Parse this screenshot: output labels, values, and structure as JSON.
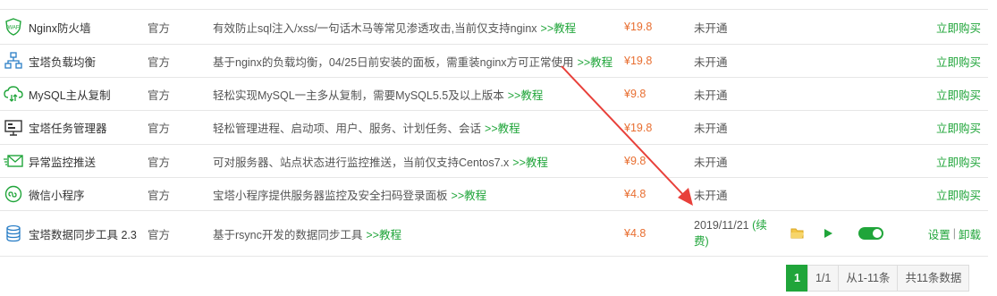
{
  "rows": [
    {
      "name": "Nginx防火墙",
      "developer": "官方",
      "description": "有效防止sql注入/xss/一句话木马等常见渗透攻击,当前仅支持nginx",
      "tutorial": ">>教程",
      "price": "¥19.8",
      "expiry": "未开通",
      "action": "立即购买",
      "icon": "waf-shield-icon"
    },
    {
      "name": "宝塔负载均衡",
      "developer": "官方",
      "description": "基于nginx的负载均衡，04/25日前安装的面板，需重装nginx方可正常使用",
      "tutorial": ">>教程",
      "price": "¥19.8",
      "expiry": "未开通",
      "action": "立即购买",
      "icon": "load-balance-icon"
    },
    {
      "name": "MySQL主从复制",
      "developer": "官方",
      "description": "轻松实现MySQL一主多从复制，需要MySQL5.5及以上版本",
      "tutorial": ">>教程",
      "price": "¥9.8",
      "expiry": "未开通",
      "action": "立即购买",
      "icon": "cloud-sync-icon"
    },
    {
      "name": "宝塔任务管理器",
      "developer": "官方",
      "description": "轻松管理进程、启动项、用户、服务、计划任务、会话",
      "tutorial": ">>教程",
      "price": "¥19.8",
      "expiry": "未开通",
      "action": "立即购买",
      "icon": "task-manager-icon"
    },
    {
      "name": "异常监控推送",
      "developer": "官方",
      "description": "可对服务器、站点状态进行监控推送，当前仅支持Centos7.x",
      "tutorial": ">>教程",
      "price": "¥9.8",
      "expiry": "未开通",
      "action": "立即购买",
      "icon": "mail-push-icon"
    },
    {
      "name": "微信小程序",
      "developer": "官方",
      "description": "宝塔小程序提供服务器监控及安全扫码登录面板",
      "tutorial": ">>教程",
      "price": "¥4.8",
      "expiry": "未开通",
      "action": "立即购买",
      "icon": "wechat-mini-icon"
    }
  ],
  "installed_row": {
    "name": "宝塔数据同步工具 2.3",
    "developer": "官方",
    "description": "基于rsync开发的数据同步工具",
    "tutorial": ">>教程",
    "price": "¥4.8",
    "expiry_date": "2019/11/21",
    "renew_open": "(续",
    "renew_close": "费)",
    "renew_text": "续费",
    "settings": "设置",
    "separator": "|",
    "uninstall": "卸载",
    "icon": "database-sync-icon"
  },
  "pagination": {
    "current": "1",
    "pages": "1/1",
    "range": "从1-11条",
    "total": "共11条数据"
  },
  "colors": {
    "accent": "#20a53a",
    "price": "#e86e30",
    "arrow": "#e8403a"
  }
}
